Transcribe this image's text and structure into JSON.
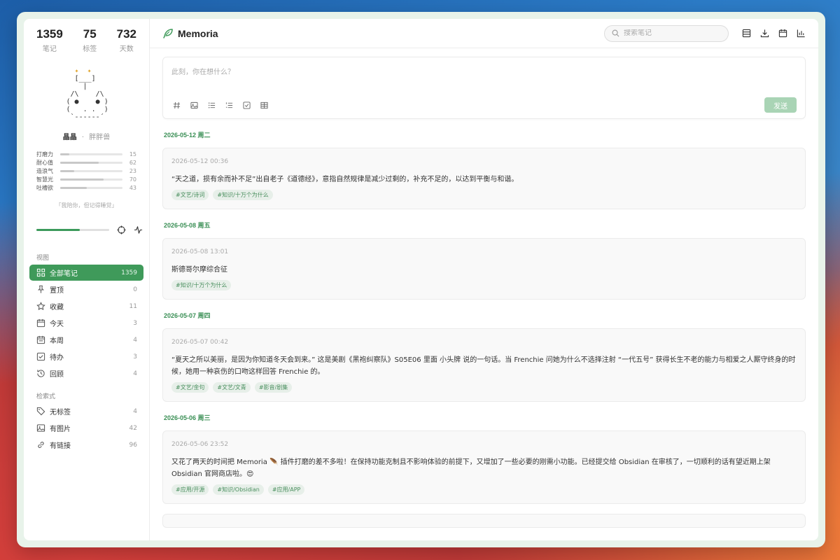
{
  "stats": [
    {
      "value": "1359",
      "label": "笔记"
    },
    {
      "value": "75",
      "label": "标签"
    },
    {
      "value": "732",
      "label": "天数"
    }
  ],
  "pet": {
    "name": "晶晶",
    "separator": "·",
    "type": "胖胖兽",
    "attributes": [
      {
        "name": "打磨力",
        "value": 15
      },
      {
        "name": "耐心值",
        "value": 62
      },
      {
        "name": "造浪气",
        "value": 23
      },
      {
        "name": "智慧光",
        "value": 70
      },
      {
        "name": "吐槽欲",
        "value": 43
      }
    ],
    "quote": "「我陪你，但记得睡觉」",
    "progress": 0.6
  },
  "sidebar": {
    "view_title": "视图",
    "filter_title": "检索式",
    "views": [
      {
        "label": "全部笔记",
        "count": "1359",
        "icon": "grid-icon"
      },
      {
        "label": "置顶",
        "count": "0",
        "icon": "pin-icon"
      },
      {
        "label": "收藏",
        "count": "11",
        "icon": "star-icon"
      },
      {
        "label": "今天",
        "count": "3",
        "icon": "calendar-icon"
      },
      {
        "label": "本周",
        "count": "4",
        "icon": "calendar-week-icon"
      },
      {
        "label": "待办",
        "count": "3",
        "icon": "checkbox-icon"
      },
      {
        "label": "回顾",
        "count": "4",
        "icon": "history-icon"
      }
    ],
    "filters": [
      {
        "label": "无标签",
        "count": "4",
        "icon": "tag-icon"
      },
      {
        "label": "有图片",
        "count": "42",
        "icon": "image-icon"
      },
      {
        "label": "有链接",
        "count": "96",
        "icon": "link-icon"
      }
    ]
  },
  "header": {
    "title": "Memoria",
    "search_placeholder": "搜索笔记"
  },
  "composer": {
    "placeholder": "此刻，你在想什么？",
    "send_label": "发送"
  },
  "days": [
    {
      "date": "2026-05-12 周二",
      "notes": [
        {
          "time": "2026-05-12 00:36",
          "text": "“天之道，损有余而补不足”出自老子《道德经》，意指自然规律是减少过剩的，补充不足的，以达到平衡与和谐。",
          "tags": [
            "#文艺/诗词",
            "#知识/十万个为什么"
          ]
        }
      ]
    },
    {
      "date": "2026-05-08 周五",
      "notes": [
        {
          "time": "2026-05-08 13:01",
          "text": "斯德哥尔摩综合征",
          "tags": [
            "#知识/十万个为什么"
          ]
        }
      ]
    },
    {
      "date": "2026-05-07 周四",
      "notes": [
        {
          "time": "2026-05-07 00:42",
          "text": "“夏天之所以美丽，是因为你知道冬天会到来。” 这是美剧《黑袍纠察队》S05E06 里面 小头牌 说的一句话。当 Frenchie 问她为什么不选择注射 “一代五号” 获得长生不老的能力与相爱之人厮守终身的时候，她用一种哀伤的口吻这样回答 Frenchie 的。",
          "tags": [
            "#文艺/金句",
            "#文艺/文青",
            "#影音/剧集"
          ]
        }
      ]
    },
    {
      "date": "2026-05-06 周三",
      "notes": [
        {
          "time": "2026-05-06 23:52",
          "text": "又花了两天的时间把 Memoria 🪶 插件打磨的差不多啦！在保持功能克制且不影响体验的前提下，又增加了一些必要的刚需小功能。已经提交给 Obsidian 在审核了，一切顺利的话有望近期上架 Obsidian 官网商店啦。😍",
          "tags": [
            "#应用/开源",
            "#知识/Obsidian",
            "#应用/APP"
          ]
        }
      ]
    }
  ],
  "colors": {
    "accent": "#3f9a5a",
    "date": "#3a8f55",
    "send_disabled": "#a9d4b5"
  }
}
